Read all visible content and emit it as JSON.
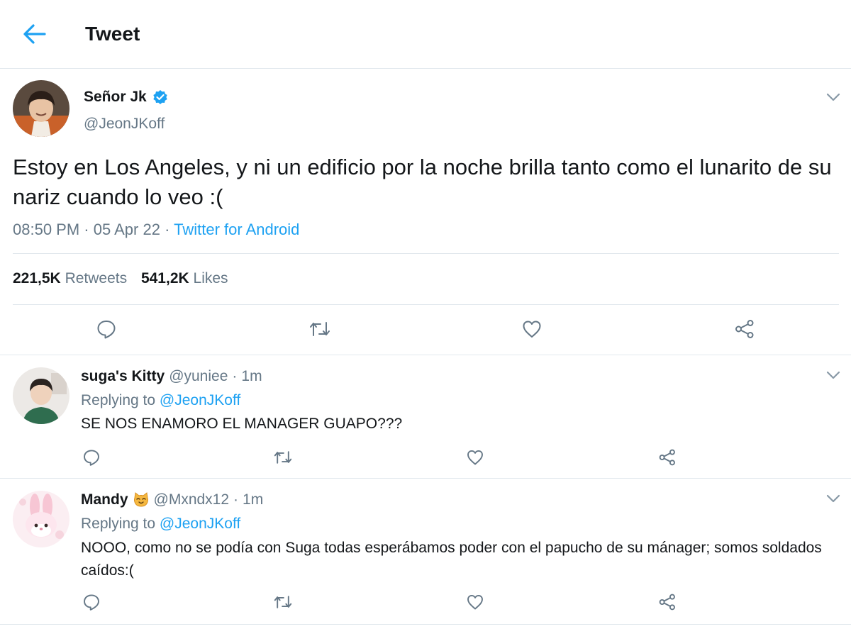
{
  "header": {
    "title": "Tweet"
  },
  "tweet": {
    "name": "Señor Jk",
    "handle": "@JeonJKoff",
    "text": "Estoy en Los Angeles, y ni un edificio por la noche brilla tanto como el lunarito de su nariz cuando lo veo :(",
    "time": "08:50 PM",
    "date": "05 Apr 22",
    "separator": "·",
    "source": "Twitter for Android",
    "retweets_count": "221,5K",
    "retweets_label": "Retweets",
    "likes_count": "541,2K",
    "likes_label": "Likes"
  },
  "replies": [
    {
      "name": "suga's Kitty",
      "handle": "@yuniee",
      "time": "1m",
      "replying_label": "Replying to",
      "replying_to": "@JeonJKoff",
      "text": "SE NOS ENAMORO EL MANAGER GUAPO???"
    },
    {
      "name": "Mandy",
      "handle": "@Mxndx12",
      "time": "1m",
      "replying_label": "Replying to",
      "replying_to": "@JeonJKoff",
      "text": "NOOO, como no se podía con Suga todas esperábamos poder con el papucho de su mánager; somos soldados caídos:("
    }
  ],
  "colors": {
    "accent": "#1da1f2",
    "text": "#14171a",
    "secondary": "#657786",
    "border": "#e1e8ed"
  },
  "icons": [
    "back-arrow-icon",
    "verified-badge-icon",
    "chevron-down-icon",
    "reply-icon",
    "retweet-icon",
    "like-icon",
    "share-icon",
    "cat-emoji-icon"
  ]
}
